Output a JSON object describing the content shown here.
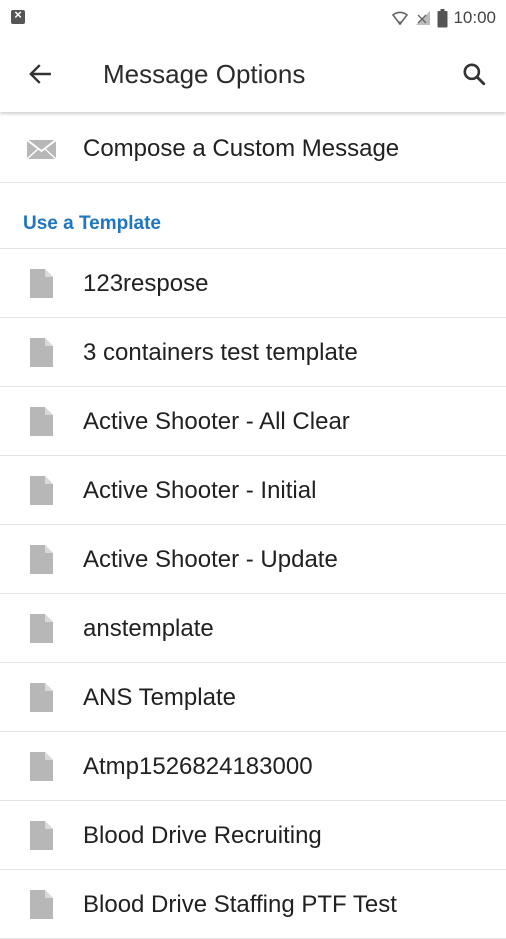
{
  "status_bar": {
    "time": "10:00"
  },
  "app_bar": {
    "title": "Message Options"
  },
  "compose": {
    "label": "Compose a Custom Message"
  },
  "section": {
    "title": "Use a Template"
  },
  "templates": [
    {
      "name": "123respose"
    },
    {
      "name": "3 containers test template"
    },
    {
      "name": "Active Shooter - All Clear"
    },
    {
      "name": "Active Shooter - Initial"
    },
    {
      "name": "Active Shooter - Update"
    },
    {
      "name": "anstemplate"
    },
    {
      "name": "ANS Template"
    },
    {
      "name": "Atmp1526824183000"
    },
    {
      "name": "Blood Drive Recruiting"
    },
    {
      "name": "Blood Drive Staffing PTF Test"
    }
  ],
  "colors": {
    "accent": "#1f76c2",
    "icon_grey": "#b7b7b7",
    "divider": "#e4e4e4"
  },
  "icons": {
    "back": "arrow-left-icon",
    "search": "search-icon",
    "compose": "envelope-icon",
    "template": "document-icon",
    "wifi": "wifi-icon",
    "signal": "signal-icon",
    "battery": "battery-icon"
  }
}
